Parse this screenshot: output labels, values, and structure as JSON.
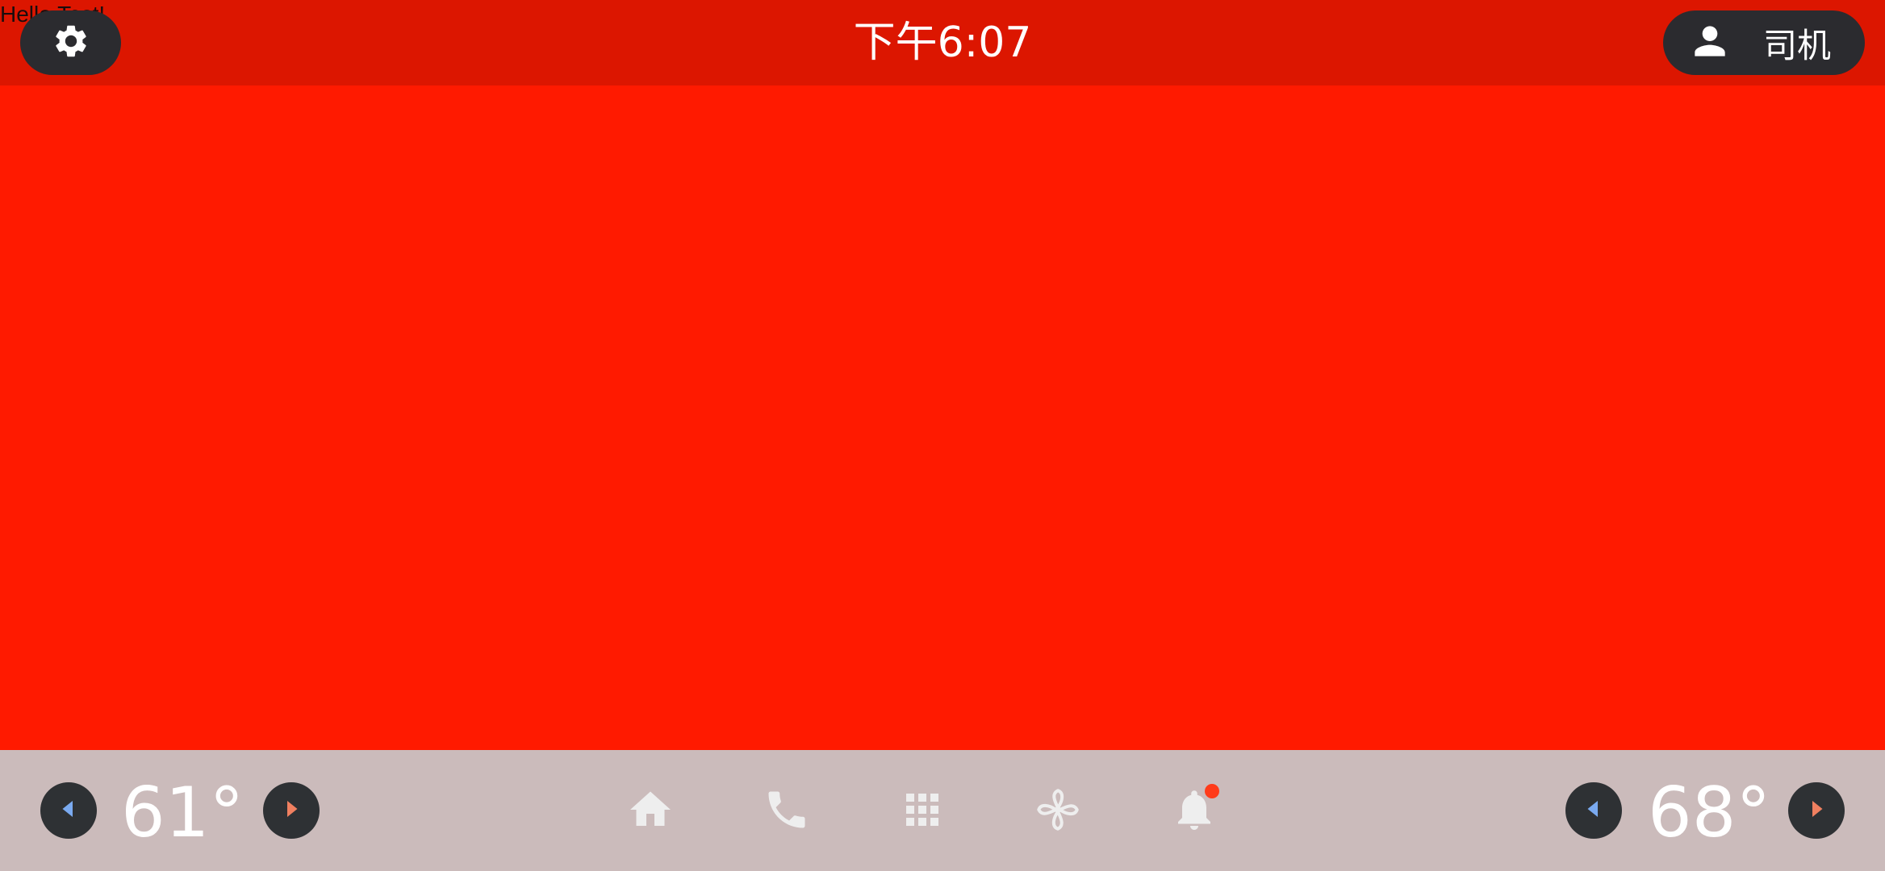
{
  "debug_text": "Hello Test!",
  "status_bar": {
    "clock": "下午6:07",
    "settings_icon": "gear-icon",
    "profile": {
      "icon": "person-icon",
      "label": "司机"
    }
  },
  "nav_bar": {
    "left_climate": {
      "temperature": "61°",
      "decrease_icon": "chevron-left-icon",
      "increase_icon": "chevron-right-icon"
    },
    "right_climate": {
      "temperature": "68°",
      "decrease_icon": "chevron-left-icon",
      "increase_icon": "chevron-right-icon"
    },
    "icons": [
      "home-icon",
      "phone-icon",
      "apps-grid-icon",
      "fan-icon",
      "bell-icon"
    ],
    "notification_badge": true
  },
  "colors": {
    "main_background": "#ff1a00",
    "status_bar_background": "#dc1600",
    "nav_bar_background": "#cbbbbb",
    "button_background": "#2b2b2f",
    "decrease_accent": "#7aaaf0",
    "increase_accent": "#f08060",
    "notification_dot": "#ff3b1a"
  }
}
